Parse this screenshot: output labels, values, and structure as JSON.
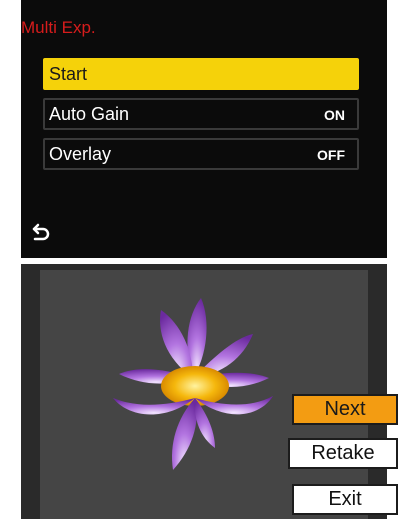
{
  "menu": {
    "title": "Multi Exp.",
    "items": [
      {
        "label": "Start",
        "value": ""
      },
      {
        "label": "Auto Gain",
        "value": "ON"
      },
      {
        "label": "Overlay",
        "value": "OFF"
      }
    ],
    "selected_color": "#f5d20a",
    "title_color": "#d61c1c",
    "back_icon": "return-arrow-icon"
  },
  "preview": {
    "subject_icon": "lotus-flower",
    "buttons": {
      "next": "Next",
      "retake": "Retake",
      "exit": "Exit"
    },
    "next_color": "#f39c12"
  }
}
